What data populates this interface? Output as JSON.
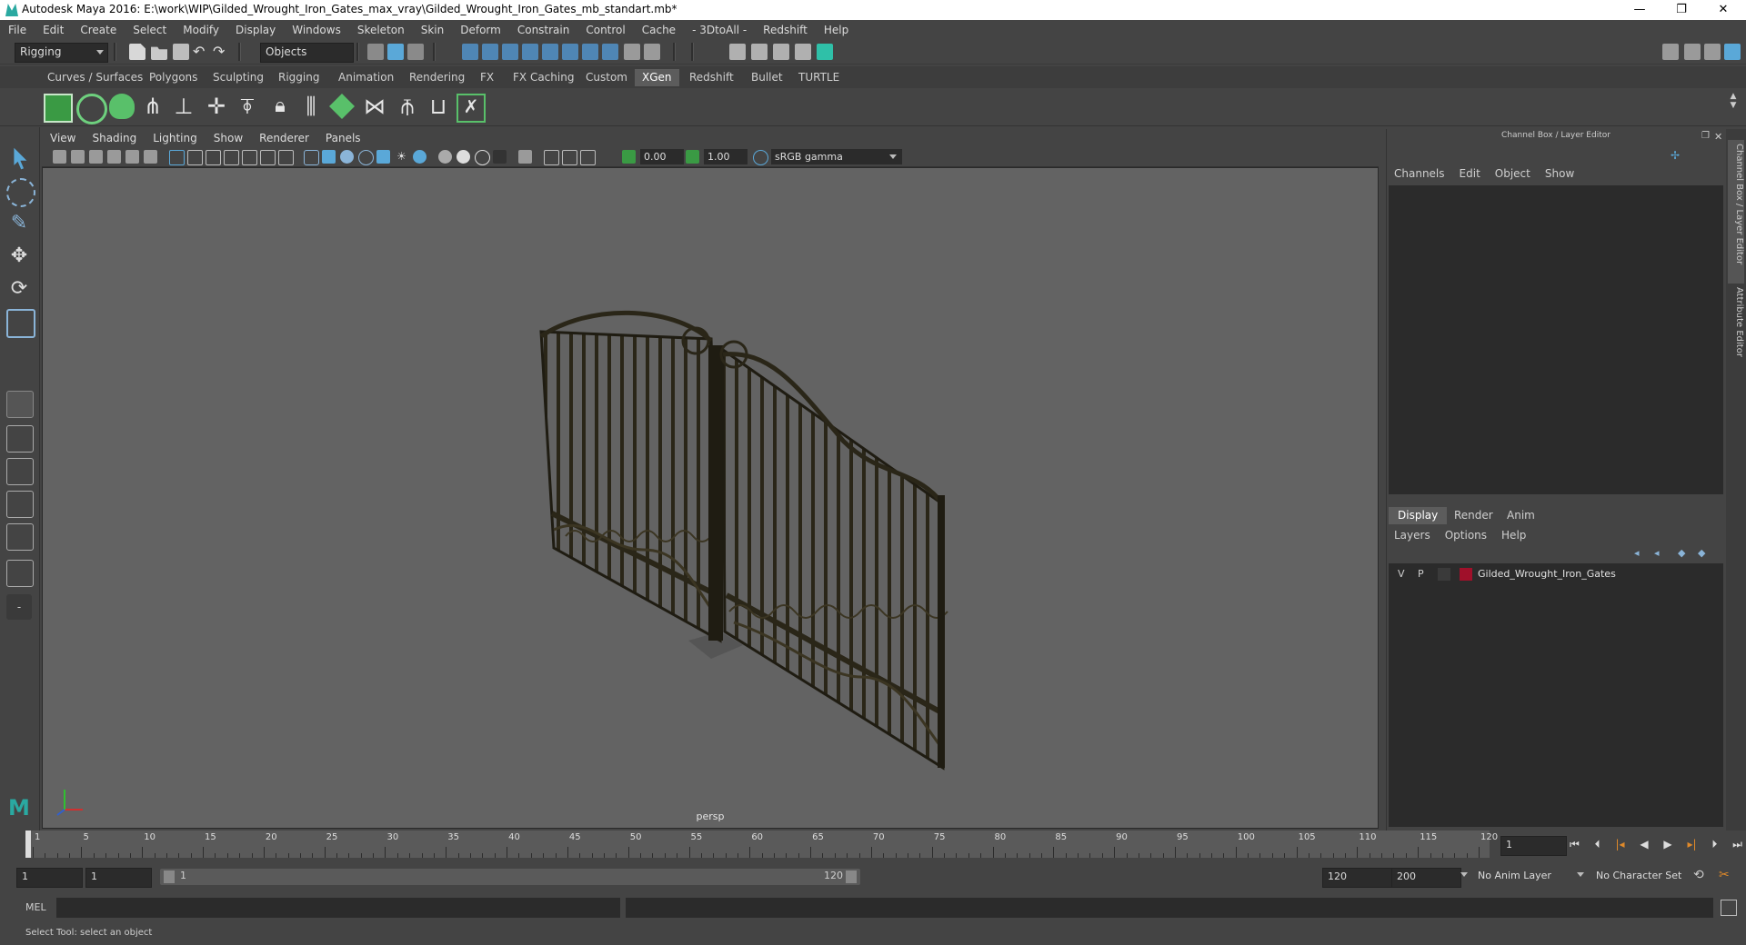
{
  "window": {
    "title": "Autodesk Maya 2016: E:\\work\\WIP\\Gilded_Wrought_Iron_Gates_max_vray\\Gilded_Wrought_Iron_Gates_mb_standart.mb*",
    "minimize": "—",
    "maximize": "❐",
    "close": "✕"
  },
  "menus": [
    "File",
    "Edit",
    "Create",
    "Select",
    "Modify",
    "Display",
    "Windows",
    "Skeleton",
    "Skin",
    "Deform",
    "Constrain",
    "Control",
    "Cache",
    "- 3DtoAll -",
    "Redshift",
    "Help"
  ],
  "status_line": {
    "menu_set": "Rigging",
    "selection_mode": "Objects"
  },
  "shelf": {
    "tabs": [
      "Curves / Surfaces",
      "Polygons",
      "Sculpting",
      "Rigging",
      "Animation",
      "Rendering",
      "FX",
      "FX Caching",
      "Custom",
      "XGen",
      "Redshift",
      "Bullet",
      "TURTLE"
    ],
    "active_tab": "XGen"
  },
  "viewport": {
    "menus": [
      "View",
      "Shading",
      "Lighting",
      "Show",
      "Renderer",
      "Panels"
    ],
    "exposure": "0.00",
    "gamma": "1.00",
    "color_space": "sRGB gamma",
    "camera": "persp"
  },
  "channel_box": {
    "header": "Channel Box / Layer Editor",
    "menus": [
      "Channels",
      "Edit",
      "Object",
      "Show"
    ]
  },
  "layer_editor": {
    "tabs": [
      "Display",
      "Render",
      "Anim"
    ],
    "active_tab": "Display",
    "menus": [
      "Layers",
      "Options",
      "Help"
    ],
    "layers": [
      {
        "visible": "V",
        "playback": "P",
        "color": "#a0102a",
        "name": "Gilded_Wrought_Iron_Gates"
      }
    ]
  },
  "side_tabs": [
    "Channel Box / Layer Editor",
    "Attribute Editor"
  ],
  "time_slider": {
    "ticks": [
      "1",
      "5",
      "10",
      "15",
      "20",
      "25",
      "30",
      "35",
      "40",
      "45",
      "50",
      "55",
      "60",
      "65",
      "70",
      "75",
      "80",
      "85",
      "90",
      "95",
      "100",
      "105",
      "110",
      "115",
      "120"
    ],
    "current_frame": "1"
  },
  "range_slider": {
    "start_time": "1",
    "playback_start": "1",
    "range_start_label": "1",
    "range_end_label": "120",
    "playback_end": "120",
    "end_time": "200",
    "anim_layer": "No Anim Layer",
    "character_set": "No Character Set"
  },
  "command_line": {
    "language": "MEL"
  },
  "help_line": "Select Tool: select an object",
  "colors": {
    "background": "#444444",
    "viewport": "#636363",
    "active_tab": "#5c5c5c",
    "accent_green": "#59c06a",
    "accent_blue": "#5aa8d8",
    "layer_color": "#a0102a"
  }
}
